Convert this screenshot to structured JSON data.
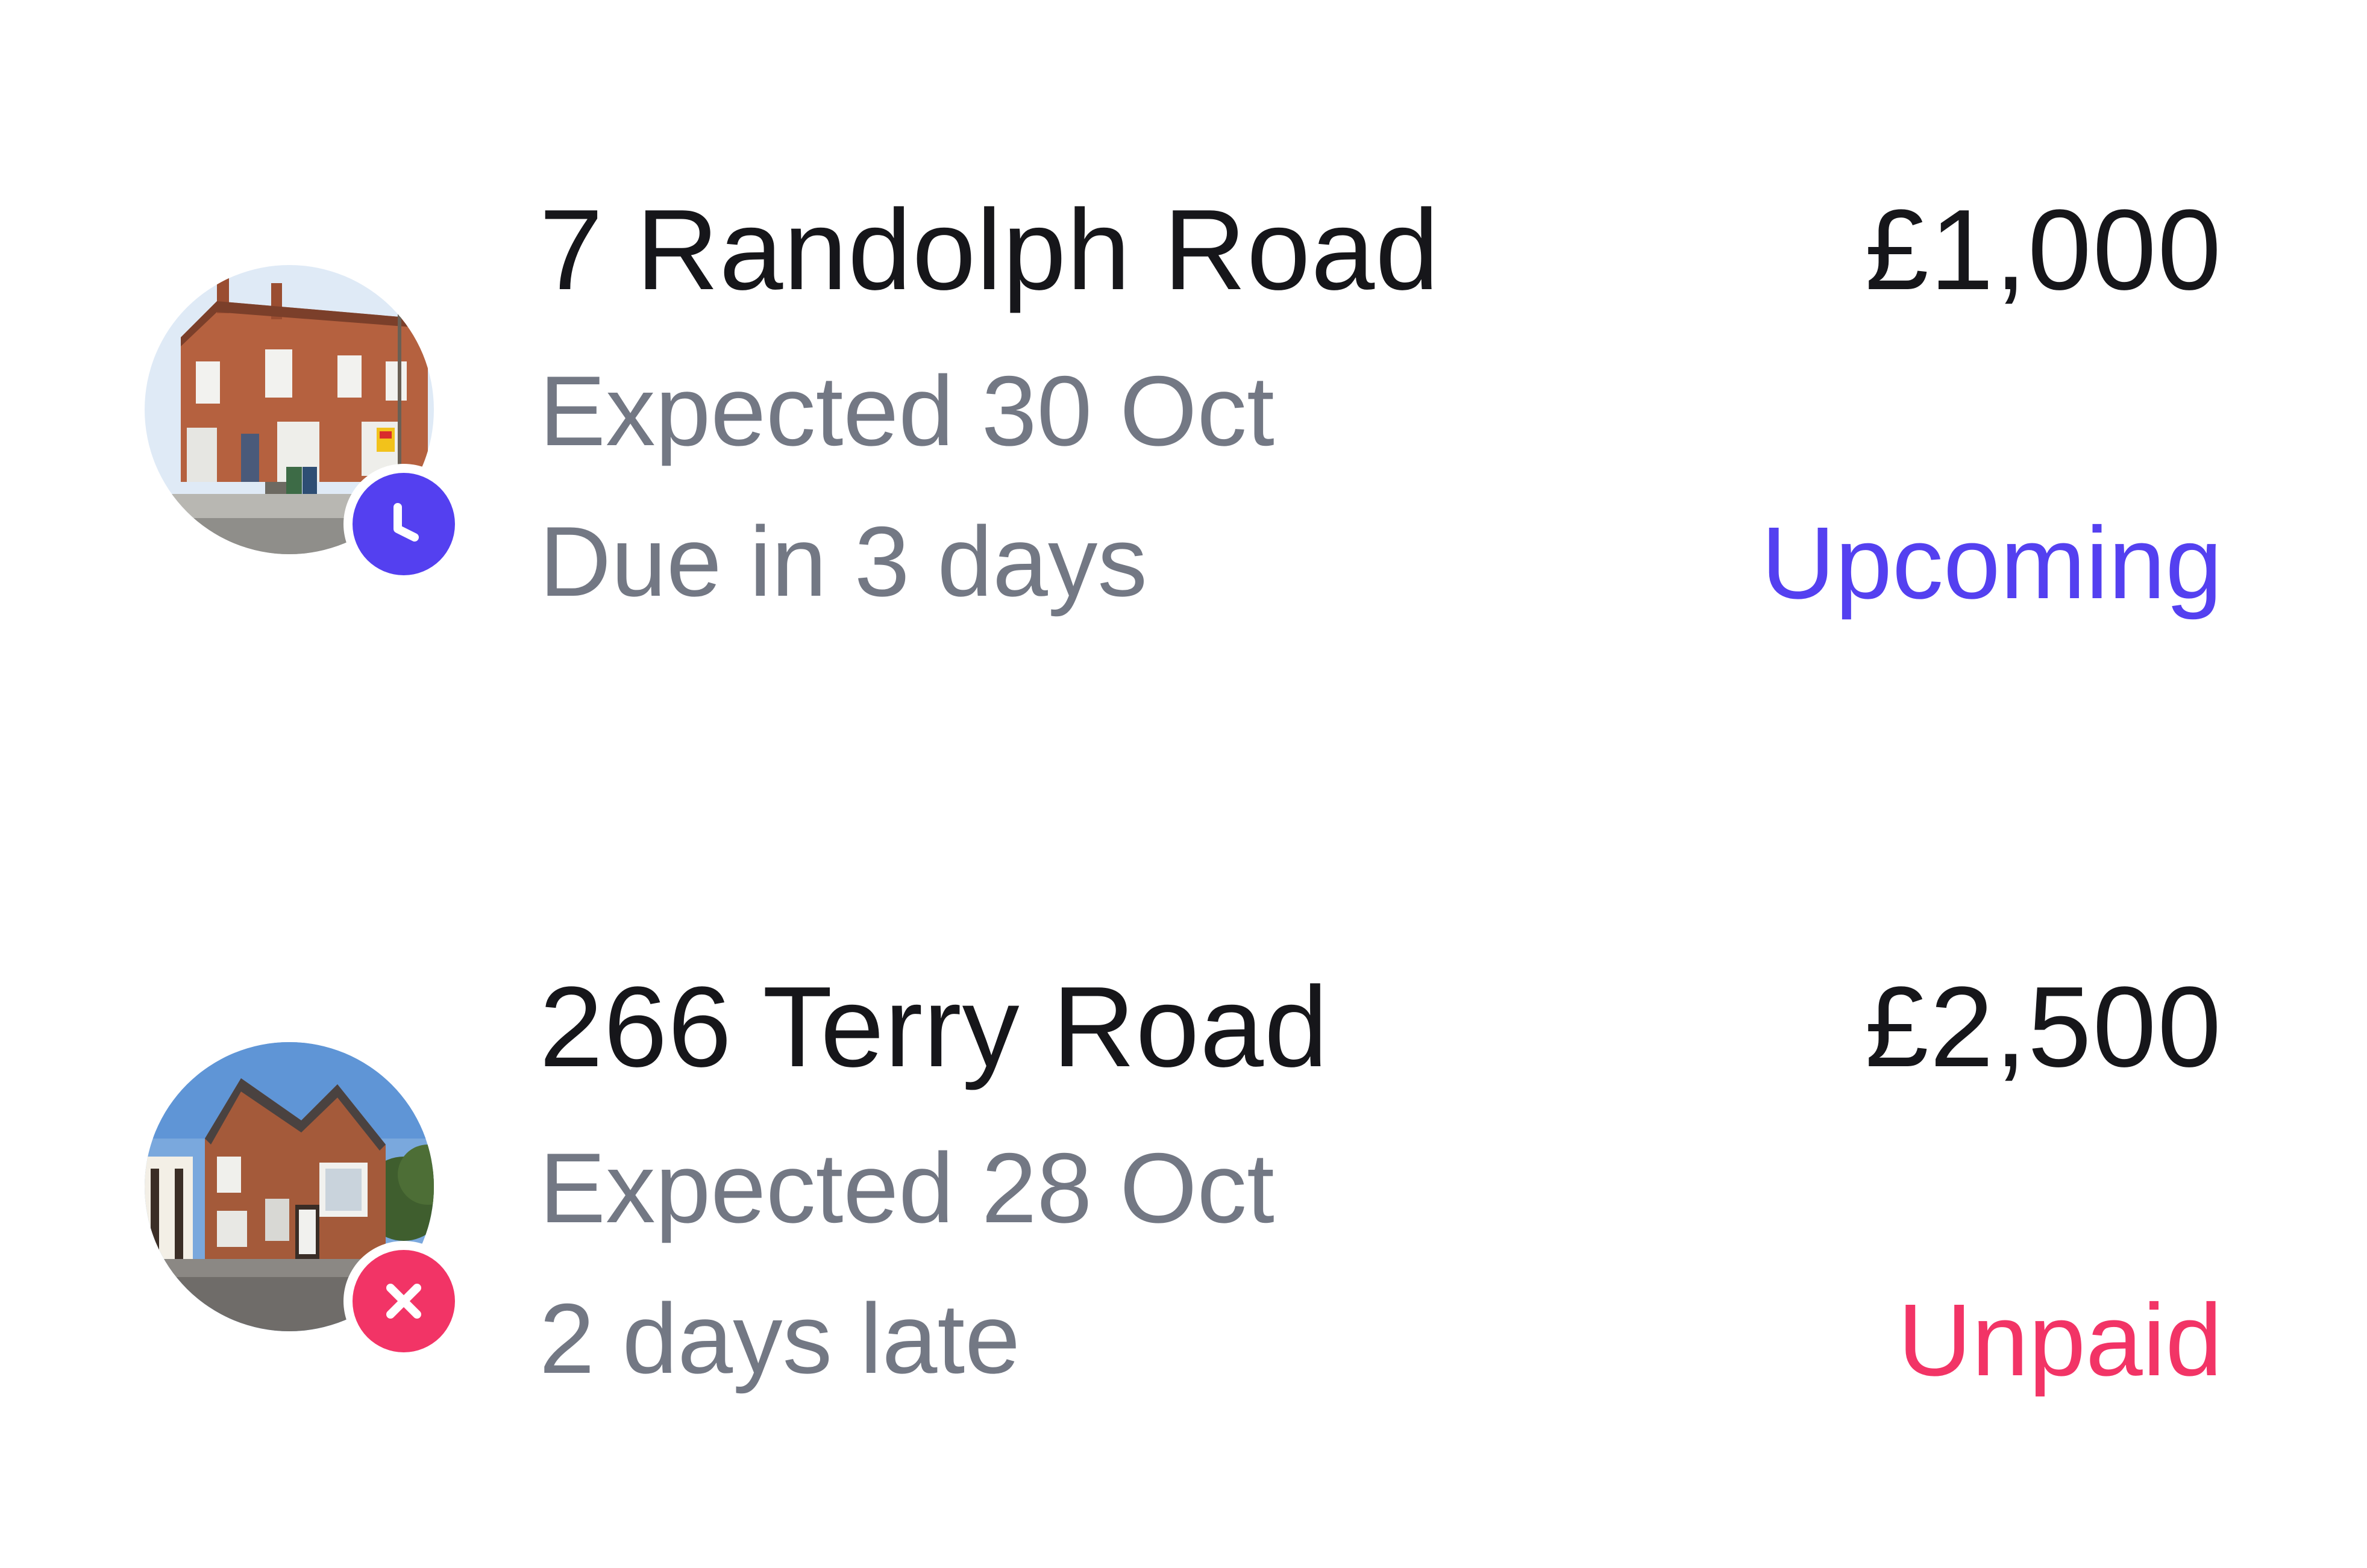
{
  "payments": [
    {
      "address": "7 Randolph Road",
      "expected": "Expected 30 Oct",
      "due_note": "Due in 3 days",
      "amount": "£1,000",
      "status": "Upcoming",
      "status_color": "#5440f0",
      "badge_icon": "clock-icon"
    },
    {
      "address": "266 Terry Road",
      "expected": "Expected 28 Oct",
      "due_note": "2 days late",
      "amount": "£2,500",
      "status": "Unpaid",
      "status_color": "#f23466",
      "badge_icon": "close-icon"
    }
  ]
}
